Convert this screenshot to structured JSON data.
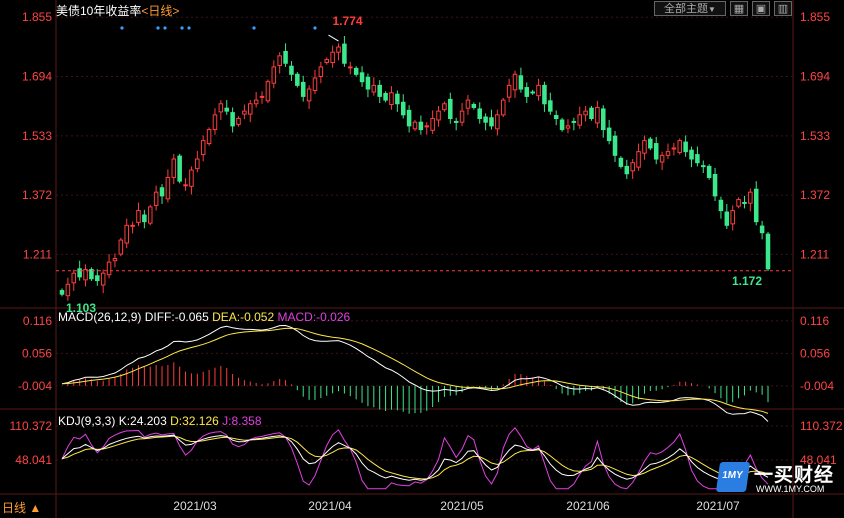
{
  "header": {
    "title": "美债10年收益率",
    "period": "<日线>",
    "theme_button": "全部主题",
    "theme_arrow": "▼"
  },
  "colors": {
    "up": "#ff3d3d",
    "down": "#3ce88c",
    "ticklabel": "#ff4444",
    "grid": "#3a1515",
    "diff": "#ffffff",
    "dea": "#ffe74a",
    "macd": "#e040e0",
    "k": "#ffffff",
    "d": "#ffe74a",
    "j": "#e040e0",
    "accent": "#ff9c34",
    "marker": "#3aa0ff"
  },
  "macd_label": {
    "params": "MACD(26,12,9)",
    "diff": "DIFF:-0.065",
    "dea": "DEA:-0.052",
    "macd": "MACD:-0.026"
  },
  "kdj_label": {
    "params": "KDJ(9,3,3)",
    "k": "K:24.203",
    "d": "D:32.126",
    "j": "J:8.358"
  },
  "period_tag": "日线 ▲",
  "logo": {
    "mark": "1MY",
    "name": "一买财经",
    "url": "WWW.1MY.COM"
  },
  "chart_data": {
    "type": "candlestick",
    "title": "美债10年收益率",
    "price_ticks": [
      "1.855",
      "1.694",
      "1.533",
      "1.372",
      "1.211"
    ],
    "price_range": [
      1.09,
      1.88
    ],
    "x_labels": [
      "2021/03",
      "2021/04",
      "2021/05",
      "2021/06",
      "2021/07"
    ],
    "annotations": {
      "high": "1.774",
      "low": "1.103",
      "last": "1.172"
    },
    "last_price": 1.172,
    "marker_count": 7,
    "closes": [
      1.103,
      1.13,
      1.16,
      1.15,
      1.17,
      1.145,
      1.14,
      1.16,
      1.19,
      1.2,
      1.25,
      1.29,
      1.29,
      1.33,
      1.3,
      1.34,
      1.38,
      1.37,
      1.42,
      1.47,
      1.41,
      1.4,
      1.44,
      1.47,
      1.52,
      1.55,
      1.59,
      1.62,
      1.6,
      1.56,
      1.58,
      1.6,
      1.62,
      1.63,
      1.64,
      1.68,
      1.72,
      1.75,
      1.73,
      1.7,
      1.67,
      1.64,
      1.66,
      1.69,
      1.72,
      1.74,
      1.76,
      1.774,
      1.73,
      1.72,
      1.7,
      1.68,
      1.66,
      1.67,
      1.64,
      1.63,
      1.65,
      1.62,
      1.59,
      1.56,
      1.57,
      1.55,
      1.56,
      1.58,
      1.6,
      1.62,
      1.58,
      1.57,
      1.6,
      1.63,
      1.61,
      1.58,
      1.57,
      1.56,
      1.59,
      1.63,
      1.67,
      1.7,
      1.66,
      1.64,
      1.65,
      1.67,
      1.62,
      1.6,
      1.58,
      1.55,
      1.56,
      1.57,
      1.59,
      1.6,
      1.58,
      1.61,
      1.55,
      1.52,
      1.48,
      1.45,
      1.43,
      1.46,
      1.49,
      1.52,
      1.5,
      1.47,
      1.48,
      1.49,
      1.5,
      1.52,
      1.49,
      1.47,
      1.46,
      1.45,
      1.42,
      1.37,
      1.33,
      1.29,
      1.33,
      1.36,
      1.35,
      1.38,
      1.3,
      1.27,
      1.172
    ],
    "macd": {
      "ylim": [
        -0.03,
        0.125
      ],
      "ticks": [
        "0.116",
        "0.056",
        "-0.004"
      ],
      "last": {
        "diff": -0.065,
        "dea": -0.052,
        "macd": -0.026
      }
    },
    "kdj": {
      "ylim": [
        0,
        125
      ],
      "ticks": [
        "110.372",
        "48.041"
      ],
      "last": {
        "k": 24.203,
        "d": 32.126,
        "j": 8.358
      }
    }
  }
}
